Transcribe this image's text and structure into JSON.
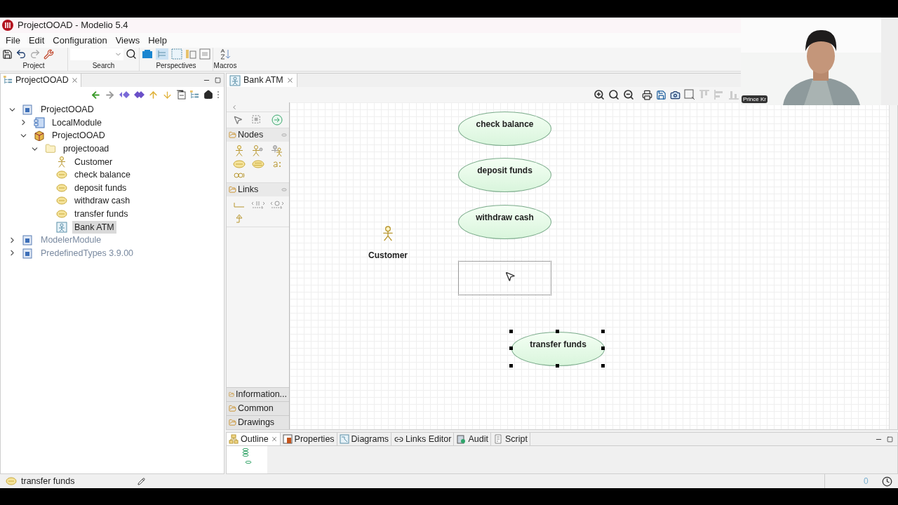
{
  "window": {
    "title": "ProjectOOAD - Modelio 5.4"
  },
  "menu": [
    "File",
    "Edit",
    "Configuration",
    "Views",
    "Help"
  ],
  "toolbar_groups": [
    {
      "label": "Project"
    },
    {
      "label": "Search"
    },
    {
      "label": "Perspectives"
    },
    {
      "label": "Macros"
    }
  ],
  "explorer": {
    "tab": "ProjectOOAD",
    "tree": [
      {
        "kind": "project",
        "label": "ProjectOOAD",
        "expanded": true,
        "selected": false,
        "disabled": false,
        "children": [
          {
            "kind": "module",
            "label": "LocalModule",
            "expanded": false,
            "selected": false,
            "disabled": false
          },
          {
            "kind": "model",
            "label": "ProjectOOAD",
            "expanded": true,
            "selected": false,
            "disabled": false,
            "children": [
              {
                "kind": "package",
                "label": "projectooad",
                "expanded": true,
                "selected": false,
                "disabled": false,
                "children": [
                  {
                    "kind": "actor",
                    "label": "Customer",
                    "selected": false,
                    "disabled": false
                  },
                  {
                    "kind": "usecase",
                    "label": "check balance",
                    "selected": false,
                    "disabled": false
                  },
                  {
                    "kind": "usecase",
                    "label": "deposit funds",
                    "selected": false,
                    "disabled": false
                  },
                  {
                    "kind": "usecase",
                    "label": "withdraw cash",
                    "selected": false,
                    "disabled": false
                  },
                  {
                    "kind": "usecase",
                    "label": "transfer funds",
                    "selected": false,
                    "disabled": false
                  },
                  {
                    "kind": "diagram",
                    "label": "Bank ATM",
                    "selected": true,
                    "disabled": false
                  }
                ]
              }
            ]
          }
        ]
      },
      {
        "kind": "project",
        "label": "ModelerModule",
        "expanded": false,
        "selected": false,
        "disabled": true
      },
      {
        "kind": "project",
        "label": "PredefinedTypes 3.9.00",
        "expanded": false,
        "selected": false,
        "disabled": true
      }
    ]
  },
  "editor": {
    "tab": "Bank ATM",
    "palette": {
      "sections": [
        {
          "label": "Nodes",
          "expanded": true
        },
        {
          "label": "Links",
          "expanded": true
        },
        {
          "label": "Information...",
          "expanded": false
        },
        {
          "label": "Common",
          "expanded": false
        },
        {
          "label": "Drawings",
          "expanded": false
        }
      ]
    },
    "diagram": {
      "elements": [
        {
          "kind": "actor",
          "name": "Customer",
          "selected": false
        },
        {
          "kind": "usecase",
          "name": "check balance",
          "selected": false
        },
        {
          "kind": "usecase",
          "name": "deposit funds",
          "selected": false
        },
        {
          "kind": "usecase",
          "name": "withdraw cash",
          "selected": false
        },
        {
          "kind": "usecase",
          "name": "transfer funds",
          "selected": true
        }
      ]
    }
  },
  "bottom_panel": {
    "tabs": [
      {
        "label": "Outline",
        "selected": true
      },
      {
        "label": "Properties",
        "selected": false
      },
      {
        "label": "Diagrams",
        "selected": false
      },
      {
        "label": "Links Editor",
        "selected": false
      },
      {
        "label": "Audit",
        "selected": false
      },
      {
        "label": "Script",
        "selected": false
      }
    ]
  },
  "status_bar": {
    "text": "transfer funds",
    "counter": "0"
  },
  "video_overlay": {
    "kind": "picture",
    "caption": "Prince Kr"
  }
}
